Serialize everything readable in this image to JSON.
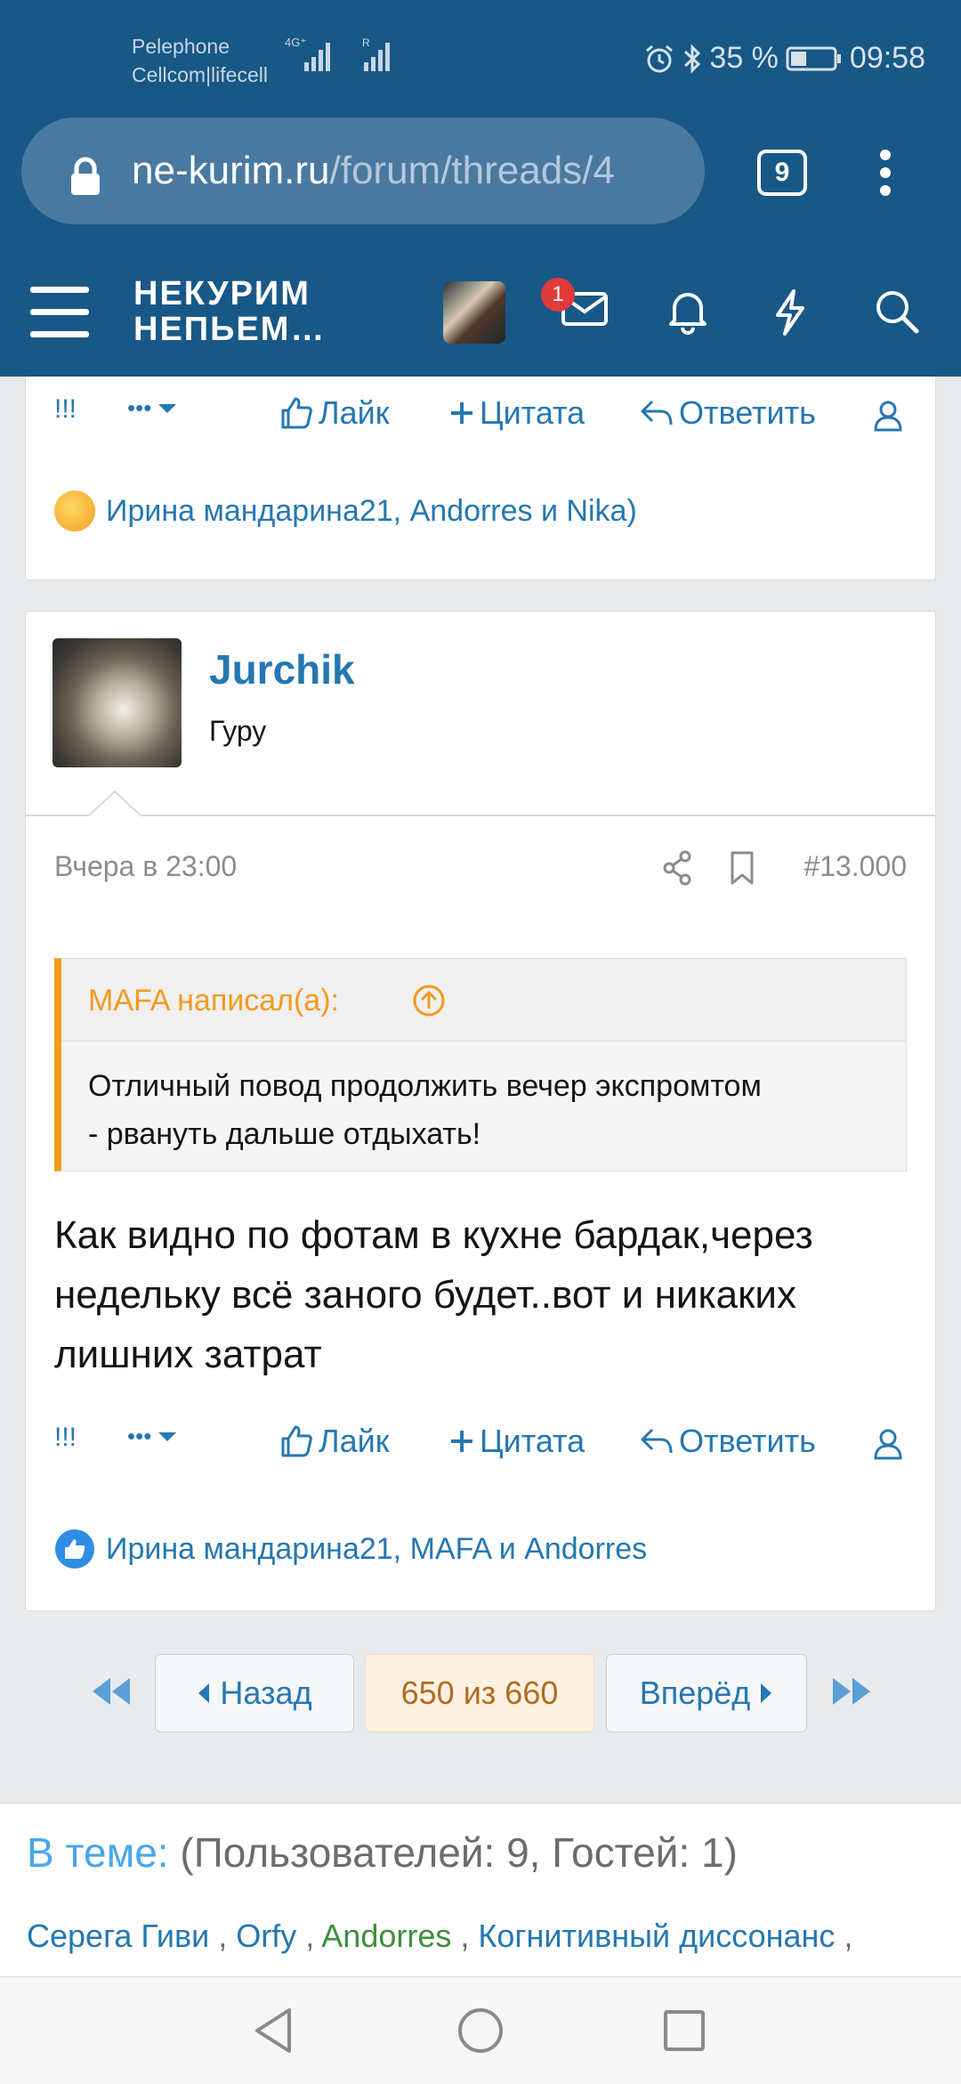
{
  "status": {
    "carrier1": "Pelephone",
    "carrier2": "Cellcom|lifecell",
    "net": "4G⁺",
    "battery": "35 %",
    "time": "09:58"
  },
  "browser": {
    "url_host": "ne-kurim.ru",
    "url_path": "/forum/threads/4",
    "tab_count": "9"
  },
  "site": {
    "logo_line1": "НЕКУРИМ",
    "logo_line2": "НЕПЬЕМ…",
    "inbox_badge": "1"
  },
  "prev_post": {
    "actions": {
      "report": "!!!",
      "more": "•••",
      "like": "Лайк",
      "quote": "Цитата",
      "reply": "Ответить"
    },
    "reactions": "Ирина мандарина21, Andorres и Nika)"
  },
  "post": {
    "username": "Jurchik",
    "rank": "Гуру",
    "date": "Вчера в 23:00",
    "number": "#13.000",
    "quote_author": "MAFA написал(а):",
    "quote_text": "Отличный повод продолжить вечер экспромтом - рвануть дальше отдыхать!",
    "body": "Как видно по фотам в кухне бардак,через недельку всё заного будет..вот и никаких лишних затрат",
    "actions": {
      "report": "!!!",
      "more": "•••",
      "like": "Лайк",
      "quote": "Цитата",
      "reply": "Ответить"
    },
    "reactions": "Ирина мандарина21, MAFA и Andorres"
  },
  "pager": {
    "back": "Назад",
    "current": "650 из 660",
    "forward": "Вперёд"
  },
  "online": {
    "label": "В теме:",
    "counts": "(Пользователей: 9, Гостей: 1)",
    "users": [
      "Серега Гиви",
      "Orfy",
      "Andorres",
      "Когнитивный диссонанс"
    ],
    "separator": " , ",
    "trailing": " ,"
  },
  "colors": {
    "brand": "#185886",
    "link": "#2577b1",
    "quote_accent": "#f39a1c",
    "page_bg": "#e9eaec"
  }
}
